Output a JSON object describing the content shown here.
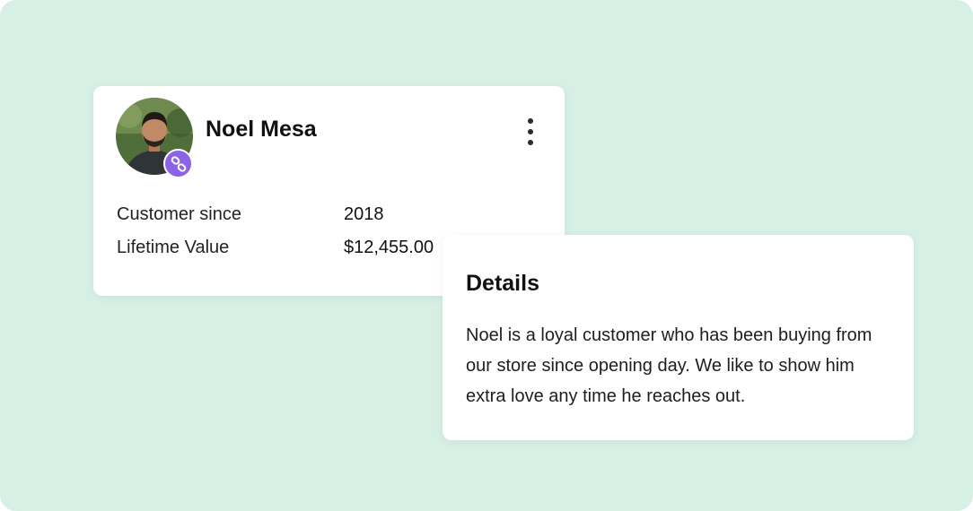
{
  "colors": {
    "background": "#d6f0e6",
    "card": "#ffffff",
    "badge": "#8b63e6"
  },
  "profile": {
    "name": "Noel Mesa",
    "avatar_icon": "person-photo",
    "badge_icon": "link-icon",
    "menu_icon": "more-vertical-icon",
    "rows": [
      {
        "label": "Customer since",
        "value": "2018"
      },
      {
        "label": "Lifetime Value",
        "value": "$12,455.00"
      }
    ]
  },
  "details": {
    "title": "Details",
    "body": "Noel is a loyal customer who has been buying from our store since opening day. We like to show him extra love any time he reaches out."
  }
}
